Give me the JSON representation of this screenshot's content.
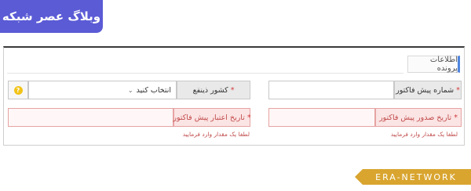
{
  "brand": {
    "title": "وبلاگ عصر شبکه"
  },
  "panel": {
    "tab_label": "اطلاعات پرونده"
  },
  "form": {
    "invoice_number_label": "شماره پیش فاکتور",
    "invoice_number_value": "",
    "beneficiary_country_label": "کشور ذینفع",
    "beneficiary_country_selected": "انتخاب کنید",
    "help_icon": "?",
    "issue_date_label": "تاریخ صدور پیش فاکتور",
    "issue_date_value": "",
    "validity_date_label": "تاریخ اعتبار پیش فاکتور",
    "validity_date_value": "",
    "required_mark": "*",
    "error_message": "لطفا یک مقدار وارد فرمایید"
  },
  "footer": {
    "watermark": "ERA-NETWORK"
  },
  "colors": {
    "brand": "#5b5bd6",
    "accent": "#4e86e0",
    "error": "#c14b4b",
    "ribbon": "#d9a52f",
    "help": "#f2c318"
  }
}
